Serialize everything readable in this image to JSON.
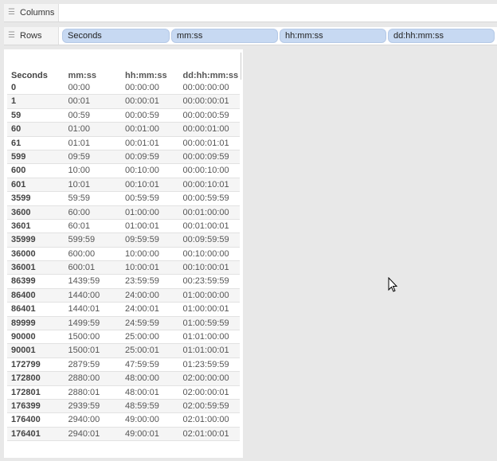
{
  "shelves": {
    "columns_label": "Columns",
    "rows_label": "Rows",
    "row_pills": [
      "Seconds",
      "mm:ss",
      "hh:mm:ss",
      "dd:hh:mm:ss"
    ]
  },
  "table": {
    "headers": [
      "Seconds",
      "mm:ss",
      "hh:mm:ss",
      "dd:hh:mm:ss"
    ],
    "rows": [
      [
        "0",
        "00:00",
        "00:00:00",
        "00:00:00:00"
      ],
      [
        "1",
        "00:01",
        "00:00:01",
        "00:00:00:01"
      ],
      [
        "59",
        "00:59",
        "00:00:59",
        "00:00:00:59"
      ],
      [
        "60",
        "01:00",
        "00:01:00",
        "00:00:01:00"
      ],
      [
        "61",
        "01:01",
        "00:01:01",
        "00:00:01:01"
      ],
      [
        "599",
        "09:59",
        "00:09:59",
        "00:00:09:59"
      ],
      [
        "600",
        "10:00",
        "00:10:00",
        "00:00:10:00"
      ],
      [
        "601",
        "10:01",
        "00:10:01",
        "00:00:10:01"
      ],
      [
        "3599",
        "59:59",
        "00:59:59",
        "00:00:59:59"
      ],
      [
        "3600",
        "60:00",
        "01:00:00",
        "00:01:00:00"
      ],
      [
        "3601",
        "60:01",
        "01:00:01",
        "00:01:00:01"
      ],
      [
        "35999",
        "599:59",
        "09:59:59",
        "00:09:59:59"
      ],
      [
        "36000",
        "600:00",
        "10:00:00",
        "00:10:00:00"
      ],
      [
        "36001",
        "600:01",
        "10:00:01",
        "00:10:00:01"
      ],
      [
        "86399",
        "1439:59",
        "23:59:59",
        "00:23:59:59"
      ],
      [
        "86400",
        "1440:00",
        "24:00:00",
        "01:00:00:00"
      ],
      [
        "86401",
        "1440:01",
        "24:00:01",
        "01:00:00:01"
      ],
      [
        "89999",
        "1499:59",
        "24:59:59",
        "01:00:59:59"
      ],
      [
        "90000",
        "1500:00",
        "25:00:00",
        "01:01:00:00"
      ],
      [
        "90001",
        "1500:01",
        "25:00:01",
        "01:01:00:01"
      ],
      [
        "172799",
        "2879:59",
        "47:59:59",
        "01:23:59:59"
      ],
      [
        "172800",
        "2880:00",
        "48:00:00",
        "02:00:00:00"
      ],
      [
        "172801",
        "2880:01",
        "48:00:01",
        "02:00:00:01"
      ],
      [
        "176399",
        "2939:59",
        "48:59:59",
        "02:00:59:59"
      ],
      [
        "176400",
        "2940:00",
        "49:00:00",
        "02:01:00:00"
      ],
      [
        "176401",
        "2940:01",
        "49:00:01",
        "02:01:00:01"
      ]
    ]
  }
}
